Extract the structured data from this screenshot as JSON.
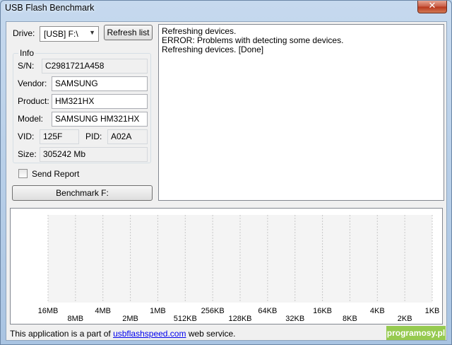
{
  "window": {
    "title": "USB Flash Benchmark",
    "close_glyph": "✕"
  },
  "drive": {
    "label": "Drive:",
    "selected": "[USB] F:\\",
    "arrow": "▼"
  },
  "refresh_button": "Refresh list",
  "info": {
    "title": "Info",
    "sn_label": "S/N:",
    "sn_value": "C2981721A458",
    "vendor_label": "Vendor:",
    "vendor_value": "SAMSUNG",
    "product_label": "Product:",
    "product_value": "HM321HX",
    "model_label": "Model:",
    "model_value": "SAMSUNG HM321HX",
    "vid_label": "VID:",
    "vid_value": "125F",
    "pid_label": "PID:",
    "pid_value": "A02A",
    "size_label": "Size:",
    "size_value": "305242 Mb"
  },
  "send_report": {
    "label": "Send Report",
    "checked": false
  },
  "benchmark_button": "Benchmark F:",
  "log": [
    "Refreshing devices.",
    "ERROR: Problems with detecting some devices.",
    "Refreshing devices. [Done]"
  ],
  "chart_data": {
    "type": "bar",
    "categories": [
      "16MB",
      "8MB",
      "4MB",
      "2MB",
      "1MB",
      "512KB",
      "256KB",
      "128KB",
      "64KB",
      "32KB",
      "16KB",
      "8KB",
      "4KB",
      "2KB",
      "1KB"
    ],
    "series": [],
    "grid": true
  },
  "footer": {
    "prefix": "This application is a part of ",
    "link": "usbflashspeed.com",
    "suffix": " web service."
  },
  "watermark": "programosy.pl"
}
